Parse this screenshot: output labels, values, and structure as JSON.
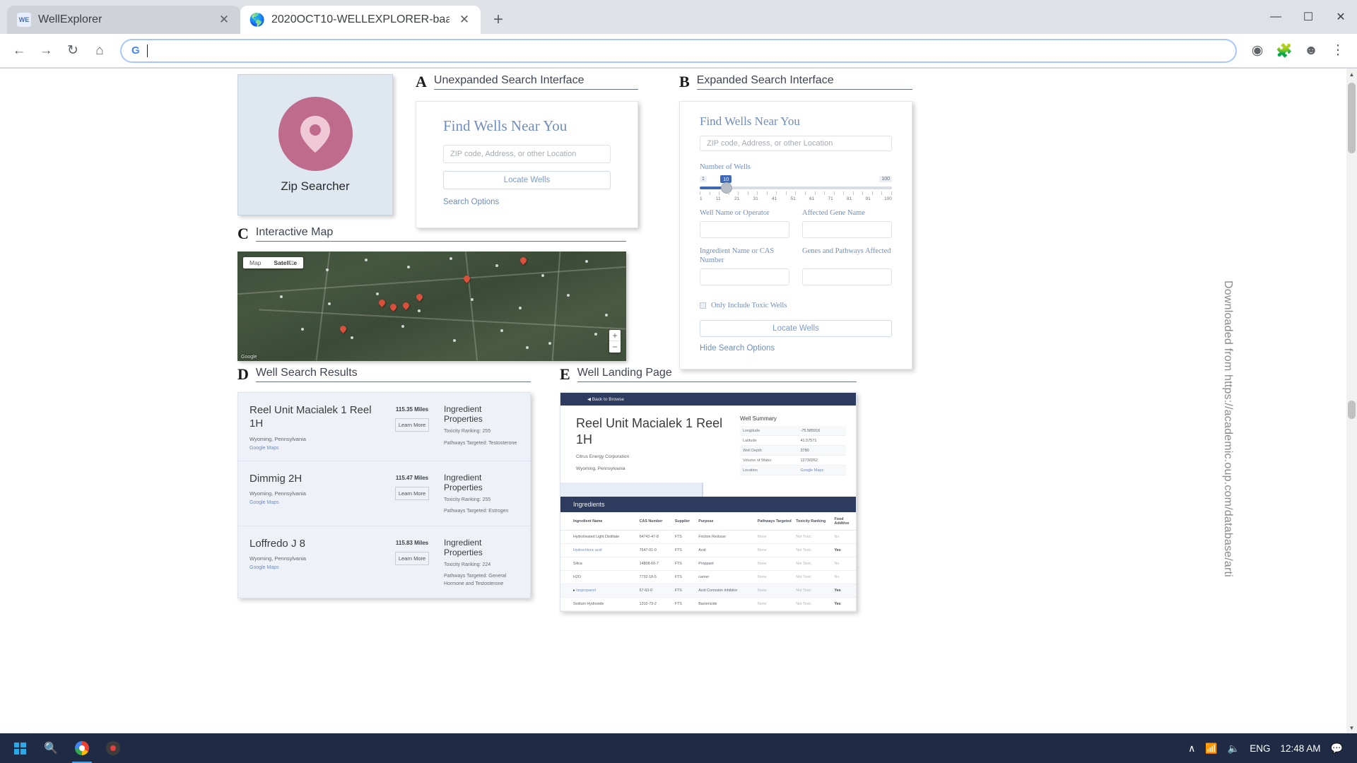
{
  "browser": {
    "tabs": [
      {
        "title": "WellExplorer",
        "favicon": "we-icon",
        "active": false
      },
      {
        "title": "2020OCT10-WELLEXPLORER-baa",
        "favicon": "globe-icon",
        "active": true
      }
    ],
    "new_tab_label": "+",
    "window_controls": {
      "minimize": "—",
      "maximize": "☐",
      "close": "✕"
    },
    "nav": {
      "back": "←",
      "forward": "→",
      "reload": "↻",
      "home": "⌂"
    },
    "omnibox": {
      "value": "",
      "placeholder": "",
      "search_icon": "G"
    },
    "toolbar_icons": {
      "share": "share-icon",
      "extensions": "puzzle-icon",
      "profile": "profile-icon",
      "menu": "kebab-menu-icon"
    }
  },
  "figure": {
    "zip_card": {
      "label": "Zip Searcher",
      "icon": "map-pin-icon",
      "color": "#bf6b8c"
    },
    "panel_a": {
      "letter": "A",
      "title": "Unexpanded Search Interface",
      "heading": "Find Wells Near You",
      "location_placeholder": "ZIP code, Address, or other Location",
      "locate_button": "Locate Wells",
      "options_link": "Search Options"
    },
    "panel_b": {
      "letter": "B",
      "title": "Expanded Search Interface",
      "heading": "Find Wells Near You",
      "location_placeholder": "ZIP code, Address, or other Location",
      "slider": {
        "label": "Number of Wells",
        "min": "1",
        "max": "100",
        "value": "10",
        "ticks": [
          "1",
          "11",
          "21",
          "31",
          "41",
          "51",
          "61",
          "71",
          "81",
          "91",
          "100"
        ]
      },
      "fields": [
        {
          "label": "Well Name or Operator",
          "value": ""
        },
        {
          "label": "Affected Gene Name",
          "value": ""
        },
        {
          "label": "Ingredient Name or CAS Number",
          "value": ""
        },
        {
          "label": "Genes and Pathways Affected",
          "value": ""
        }
      ],
      "checkbox_label": "Only Include Toxic Wells",
      "checkbox_checked": false,
      "locate_button": "Locate Wells",
      "hide_link": "Hide Search Options"
    },
    "panel_c": {
      "letter": "C",
      "title": "Interactive Map",
      "map_type_buttons": [
        "Map",
        "Satellite"
      ],
      "active_map_type": "Satellite",
      "zoom_in": "+",
      "zoom_out": "−",
      "attribution": "Google"
    },
    "panel_d": {
      "letter": "D",
      "title": "Well Search Results",
      "results": [
        {
          "name": "Reel Unit Macialek 1 Reel 1H",
          "location": "Wyoming, Pennsylvania",
          "map_link": "Google Maps",
          "distance": "115.35 Miles",
          "learn_more": "Learn More",
          "properties_title": "Ingredient Properties",
          "toxicity": "Toxicity Ranking: 255",
          "pathways": "Pathways Targeted: Testosterone"
        },
        {
          "name": "Dimmig 2H",
          "location": "Wyoming, Pennsylvania",
          "map_link": "Google Maps",
          "distance": "115.47 Miles",
          "learn_more": "Learn More",
          "properties_title": "Ingredient Properties",
          "toxicity": "Toxicity Ranking: 255",
          "pathways": "Pathways Targeted: Estrogen"
        },
        {
          "name": "Loffredo J 8",
          "location": "Wyoming, Pennsylvania",
          "map_link": "Google Maps",
          "distance": "115.83 Miles",
          "learn_more": "Learn More",
          "properties_title": "Ingredient Properties",
          "toxicity": "Toxicity Ranking: 224",
          "pathways": "Pathways Targeted: General Hormone and Testosterone"
        }
      ]
    },
    "panel_e": {
      "letter": "E",
      "title": "Well Landing Page",
      "back_link": "◀ Back to Browse",
      "well_name": "Reel Unit Macialek 1 Reel 1H",
      "operator": "Citrus Energy Corporation",
      "location": "Wyoming, Pennsylvania",
      "summary_title": "Well Summary",
      "summary_rows": [
        {
          "label": "Longitude",
          "value": "-75.585916",
          "link": false
        },
        {
          "label": "Latitude",
          "value": "41.57571",
          "link": false
        },
        {
          "label": "Well Depth",
          "value": "3780",
          "link": false
        },
        {
          "label": "Volume of Water",
          "value": "12730262",
          "link": false
        },
        {
          "label": "Location",
          "value": "Google Maps",
          "link": true
        }
      ],
      "ingredients_title": "Ingredients",
      "ingredients_columns": [
        "Ingredient Name",
        "CAS Number",
        "Supplier",
        "Purpose",
        "Pathways Targeted",
        "Toxicity Ranking",
        "Food Additive"
      ],
      "ingredients_rows": [
        {
          "name": "Hydrotreated Light Distillate",
          "cas": "64742-47-8",
          "supplier": "FTS",
          "purpose": "Friction Reducer",
          "pathways": "None",
          "toxicity": "Not Toxic",
          "food": "No",
          "link": false,
          "expand": false
        },
        {
          "name": "Hydrochloric acid",
          "cas": "7647-01-0",
          "supplier": "FTS",
          "purpose": "Acid",
          "pathways": "None",
          "toxicity": "Not Toxic",
          "food": "Yes",
          "link": true,
          "expand": false
        },
        {
          "name": "Silica",
          "cas": "14808-60-7",
          "supplier": "FTS",
          "purpose": "Proppant",
          "pathways": "None",
          "toxicity": "Not Toxic",
          "food": "No",
          "link": false,
          "expand": false
        },
        {
          "name": "H2O",
          "cas": "7732-18-5",
          "supplier": "FTS",
          "purpose": "carrier",
          "pathways": "None",
          "toxicity": "Not Toxic",
          "food": "No",
          "link": false,
          "expand": false
        },
        {
          "name": "Isopropanol",
          "cas": "67-63-0",
          "supplier": "FTS",
          "purpose": "Acid Corrosion Inhibitor",
          "pathways": "None",
          "toxicity": "Not Toxic",
          "food": "Yes",
          "link": true,
          "expand": true
        },
        {
          "name": "Sodium Hydroxide",
          "cas": "1310-73-2",
          "supplier": "FTS",
          "purpose": "Bactericide",
          "pathways": "None",
          "toxicity": "Not Toxic",
          "food": "Yes",
          "link": false,
          "expand": false
        }
      ]
    },
    "watermark": "Downloaded from https://academic.oup.com/database/arti"
  },
  "taskbar": {
    "start": "windows-logo-icon",
    "search": "search-icon",
    "apps": [
      "chrome-icon",
      "recorder-icon"
    ],
    "tray": {
      "chevron": "∧",
      "network": "wifi-icon",
      "volume": "speaker-icon",
      "language": "ENG",
      "clock": "12:48 AM",
      "notifications": "notification-icon"
    }
  }
}
